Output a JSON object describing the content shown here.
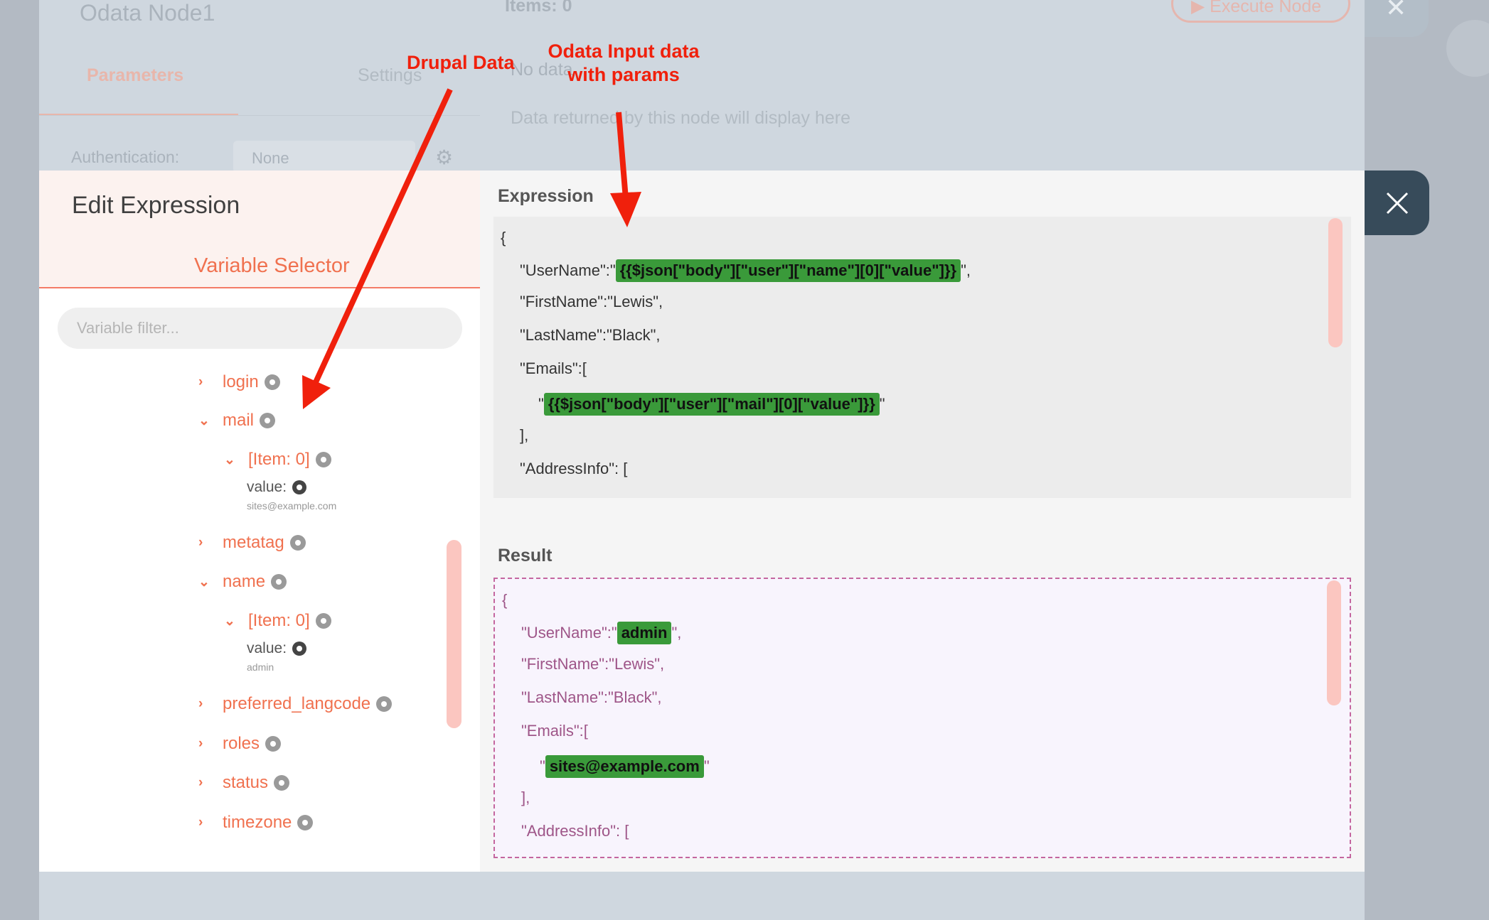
{
  "background": {
    "node_title": "Odata Node1",
    "tab_parameters": "Parameters",
    "tab_settings": "Settings",
    "items_label": "Items: 0",
    "no_data": "No data",
    "data_returned": "Data returned by this node will display here",
    "auth_label": "Authentication:",
    "auth_value": "None",
    "execute_button": "Execute Node"
  },
  "modal": {
    "title": "Edit Expression",
    "variable_selector_tab": "Variable Selector",
    "filter_placeholder": "Variable filter...",
    "expression_label": "Expression",
    "result_label": "Result"
  },
  "tree": {
    "login": "login",
    "mail": "mail",
    "mail_item": "[Item: 0]",
    "mail_value_key": "value:",
    "mail_value": "sites@example.com",
    "metatag": "metatag",
    "name": "name",
    "name_item": "[Item: 0]",
    "name_value_key": "value:",
    "name_value": "admin",
    "preferred_langcode": "preferred_langcode",
    "roles": "roles",
    "status": "status",
    "timezone": "timezone"
  },
  "expression": {
    "open_brace": "{",
    "username_prefix": "\"UserName\":\"",
    "username_expr": "{{$json[\"body\"][\"user\"][\"name\"][0][\"value\"]}}",
    "username_suffix": "\",",
    "firstname": "\"FirstName\":\"Lewis\",",
    "lastname": "\"LastName\":\"Black\",",
    "emails_open": "\"Emails\":[",
    "email_prefix": "\"",
    "email_expr": "{{$json[\"body\"][\"user\"][\"mail\"][0][\"value\"]}}",
    "email_suffix": "\"",
    "emails_close": "],",
    "addressinfo": "\"AddressInfo\": ["
  },
  "result": {
    "open_brace": "{",
    "username_prefix": "\"UserName\":\"",
    "username_value": "admin",
    "username_suffix": "\",",
    "firstname": "\"FirstName\":\"Lewis\",",
    "lastname": "\"LastName\":\"Black\",",
    "emails_open": "\"Emails\":[",
    "email_prefix": "\"",
    "email_value": "sites@example.com",
    "email_suffix": "\"",
    "emails_close": "],",
    "addressinfo": "\"AddressInfo\": ["
  },
  "annotations": {
    "drupal_data": "Drupal Data",
    "odata_line1": "Odata Input data",
    "odata_line2": "with params",
    "color": "#f0200c"
  },
  "colors": {
    "accent": "#f0714f",
    "highlight": "#3a9a3a",
    "close_button": "#374b5a"
  }
}
